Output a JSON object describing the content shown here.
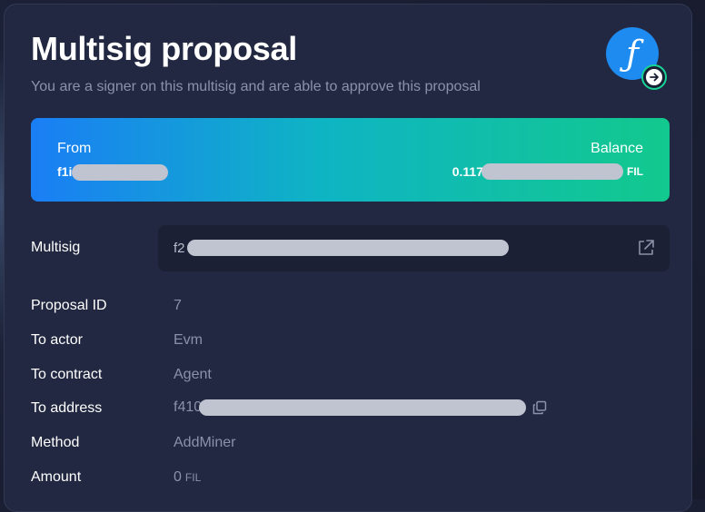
{
  "header": {
    "title": "Multisig proposal",
    "subtitle": "You are a signer on this multisig and are able to approve this proposal"
  },
  "banner": {
    "from_label": "From",
    "from_value": "f1i",
    "balance_label": "Balance",
    "balance_value": "0.117",
    "balance_unit": "FIL"
  },
  "multisig": {
    "label": "Multisig",
    "value": "f2"
  },
  "details": {
    "proposal_id_label": "Proposal ID",
    "proposal_id_value": "7",
    "to_actor_label": "To actor",
    "to_actor_value": "Evm",
    "to_contract_label": "To contract",
    "to_contract_value": "Agent",
    "to_address_label": "To address",
    "to_address_value": "f410",
    "method_label": "Method",
    "method_value": "AddMiner",
    "amount_label": "Amount",
    "amount_value": "0",
    "amount_unit": "FIL"
  },
  "colors": {
    "accent_green": "#17d395",
    "filecoin_blue": "#1e8bf0",
    "card_bg": "#222841"
  },
  "icons": [
    "filecoin-logo-icon",
    "arrow-right-icon",
    "external-link-icon",
    "copy-icon"
  ]
}
